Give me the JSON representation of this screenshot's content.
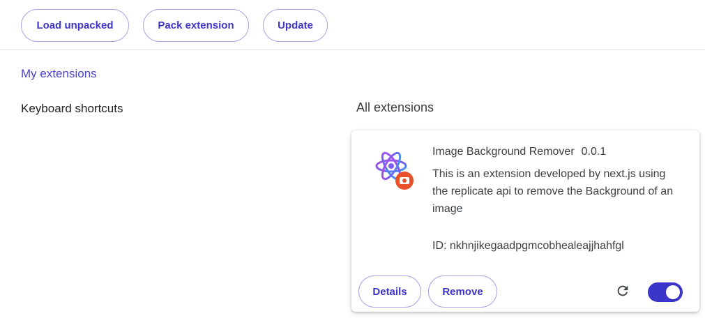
{
  "toolbar": {
    "load_unpacked": "Load unpacked",
    "pack_extension": "Pack extension",
    "update": "Update"
  },
  "sidebar": {
    "my_extensions": "My extensions",
    "keyboard_shortcuts": "Keyboard shortcuts"
  },
  "main": {
    "section_title": "All extensions",
    "extension": {
      "name": "Image Background Remover",
      "version": "0.0.1",
      "description": "This is an extension developed by next.js using the replicate api to remove the Background of an image",
      "id_text": "ID: nkhnjikegaadpgmcobhealeajjhahfgl",
      "details_label": "Details",
      "remove_label": "Remove",
      "enabled": true,
      "icon": "react-atom-with-camera-badge-icon"
    }
  },
  "colors": {
    "accent": "#3c35c9",
    "link": "#4a43cf",
    "button_border": "#a8a3e6",
    "badge": "#e8502a"
  }
}
